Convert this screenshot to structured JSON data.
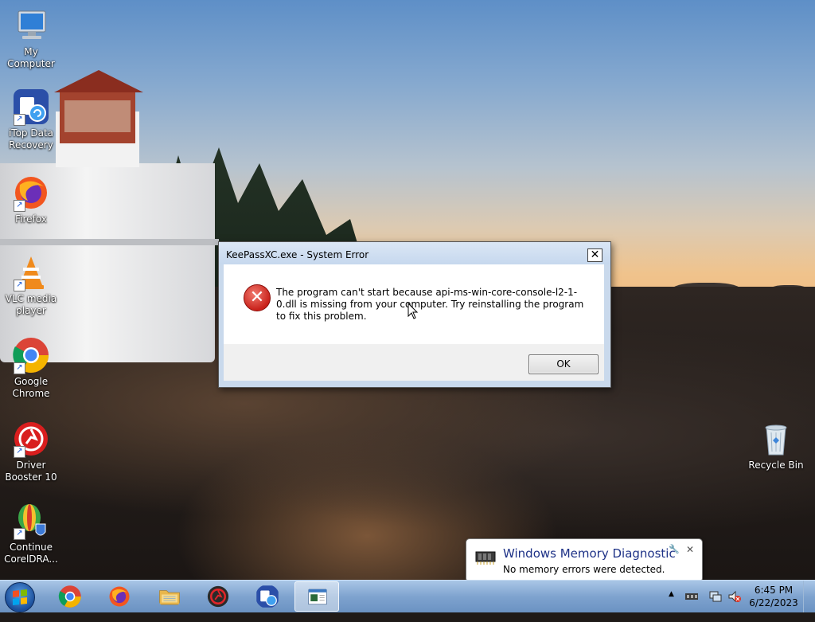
{
  "desktop": {
    "icons": [
      {
        "label": "My Computer",
        "icon": "computer-icon"
      },
      {
        "label": "iTop Data Recovery",
        "icon": "data-recovery-icon"
      },
      {
        "label": "Firefox",
        "icon": "firefox-icon"
      },
      {
        "label": "VLC media player",
        "icon": "vlc-icon"
      },
      {
        "label": "Google Chrome",
        "icon": "chrome-icon"
      },
      {
        "label": "Driver Booster 10",
        "icon": "driver-booster-icon"
      },
      {
        "label": "Continue CorelDRA...",
        "icon": "coreldraw-icon"
      }
    ],
    "recycle_bin": {
      "label": "Recycle Bin",
      "icon": "recycle-bin-icon"
    }
  },
  "dialog": {
    "title": "KeePassXC.exe - System Error",
    "close_glyph": "✕",
    "message": "The program can't start because api-ms-win-core-console-l2-1-0.dll is missing from your computer. Try reinstalling the program to fix this problem.",
    "ok_label": "OK",
    "icon": "error-icon"
  },
  "balloon": {
    "title": "Windows Memory Diagnostic",
    "text": "No memory errors were detected.",
    "close_glyph": "✕",
    "pin_glyph": "🔧"
  },
  "taskbar": {
    "pinned": [
      {
        "name": "chrome",
        "icon": "chrome-icon"
      },
      {
        "name": "firefox",
        "icon": "firefox-icon"
      },
      {
        "name": "explorer",
        "icon": "folder-icon"
      },
      {
        "name": "driver-booster",
        "icon": "driver-booster-icon"
      },
      {
        "name": "itop",
        "icon": "data-recovery-icon"
      },
      {
        "name": "keepassxc-error",
        "icon": "window-icon",
        "active": true
      }
    ],
    "tray": {
      "up_arrow": "▲",
      "time": "6:45 PM",
      "date": "6/22/2023"
    }
  },
  "colors": {
    "taskbar": "#7fa3cf",
    "dialog_frame": "#c9d9ec",
    "error_red": "#c9221b",
    "balloon_title": "#1e3287"
  }
}
